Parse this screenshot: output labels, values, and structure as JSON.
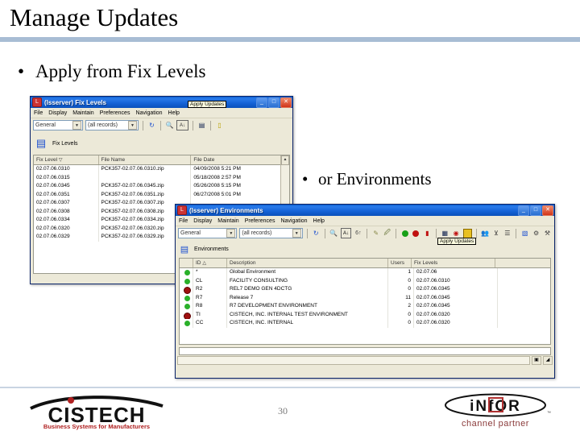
{
  "slide": {
    "title": "Manage Updates",
    "bullet1": "Apply from Fix Levels",
    "bullet2": "or Environments",
    "page_number": "30",
    "rule_color": "#a8bdd4"
  },
  "fixlevels_window": {
    "title": "(lsserver) Fix Levels",
    "icon": "app-icon",
    "min_label": "_",
    "max_label": "□",
    "close_label": "✕",
    "menus": [
      "File",
      "Display",
      "Maintain",
      "Preferences",
      "Navigation",
      "Help"
    ],
    "toolbar": {
      "view_combo": "General",
      "filter_combo": "(all records)",
      "refresh_icon": "refresh-icon",
      "find_icon": "binoculars-icon",
      "sort_icon": "sort-icon",
      "export_icon": "export-icon",
      "note_icon": "note-icon"
    },
    "panel_label": "Fix Levels",
    "tooltip": "Apply Updates",
    "columns": [
      "Fix Level",
      "File Name",
      "File Date"
    ],
    "rows": [
      {
        "level": "02.07.06.0310",
        "file": "PCK357-02.07.06.0310.zip",
        "date": "04/09/2008 5:21 PM"
      },
      {
        "level": "02.07.06.0315",
        "file": "",
        "date": "05/18/2008 2:57 PM"
      },
      {
        "level": "02.07.06.0345",
        "file": "PCK357-02.07.06.0345.zip",
        "date": "05/26/2008 5:15 PM"
      },
      {
        "level": "02.07.06.0351",
        "file": "PCK357-02.07.06.0351.zip",
        "date": "06/27/2008 5:01 PM"
      },
      {
        "level": "02.07.06.0307",
        "file": "PCK357-02.07.06.0307.zip",
        "date": ""
      },
      {
        "level": "02.07.06.0308",
        "file": "PCK357-02.07.06.0308.zip",
        "date": ""
      },
      {
        "level": "02.07.06.0334",
        "file": "PCK357-02.07.06.0334.zip",
        "date": ""
      },
      {
        "level": "02.07.06.0320",
        "file": "PCK357-02.07.06.0320.zip",
        "date": ""
      },
      {
        "level": "02.07.06.0329",
        "file": "PCK357-02.07.06.0329.zip",
        "date": ""
      }
    ]
  },
  "environments_window": {
    "title": "(lsserver) Environments",
    "icon": "app-icon",
    "min_label": "_",
    "max_label": "□",
    "close_label": "✕",
    "menus": [
      "File",
      "Display",
      "Maintain",
      "Preferences",
      "Navigation",
      "Help"
    ],
    "toolbar": {
      "view_combo": "General",
      "filter_combo": "(all records)",
      "refresh_icon": "refresh-icon",
      "find_icon": "binoculars-icon",
      "sort_icon": "sort-icon",
      "filter_icon": "filter-icon",
      "edit_icon": "pencil-icon",
      "new_icon": "new-doc-icon",
      "start_icon": "green-circle-icon",
      "stop_icon": "red-stop-icon",
      "restart_icon": "red-pin-icon",
      "users_icon": "users-icon",
      "globe_icon": "globe-icon",
      "apply_icon": "apply-updates-icon",
      "people_icon": "people-icon",
      "funnel_icon": "funnel-icon",
      "list_icon": "list-icon",
      "chart_icon": "chart-icon",
      "gear1_icon": "gear-icon",
      "gear2_icon": "settings-icon"
    },
    "panel_label": "Environments",
    "tooltip": "Apply Updates",
    "columns": [
      "ID",
      "Description",
      "Users",
      "Fix Levels"
    ],
    "rows": [
      {
        "status": "ok",
        "color": "#2ab02a",
        "id": "*",
        "description": "Global Environment",
        "users": "1",
        "fix": "02.07.06"
      },
      {
        "status": "ok",
        "color": "#2ab02a",
        "id": "CL",
        "description": "FACILITY CONSULTING",
        "users": "0",
        "fix": "02.07.06.0310"
      },
      {
        "status": "stop",
        "color": "#a01010",
        "id": "R2",
        "description": "REL7 DEMO GEN 4DCTG",
        "users": "0",
        "fix": "02.07.06.0345"
      },
      {
        "status": "ok",
        "color": "#2ab02a",
        "id": "R7",
        "description": "Release 7",
        "users": "11",
        "fix": "02.07.06.0345"
      },
      {
        "status": "ok",
        "color": "#2ab02a",
        "id": "R8",
        "description": "R7 DEVELOPMENT ENVIRONMENT",
        "users": "2",
        "fix": "02.07.06.0345"
      },
      {
        "status": "stop",
        "color": "#a01010",
        "id": "TI",
        "description": "CISTECH, INC. INTERNAL TEST ENVIRONMENT",
        "users": "0",
        "fix": "02.07.06.0320"
      },
      {
        "status": "ok",
        "color": "#2ab02a",
        "id": "CC",
        "description": "CISTECH, INC. INTERNAL",
        "users": "0",
        "fix": "02.07.06.0320"
      }
    ]
  },
  "footer": {
    "cistech_name": "CISTECH",
    "cistech_tagline": "Business Systems for Manufacturers",
    "infor_name": "iNfOR",
    "infor_sub": "channel partner",
    "infor_accent": "#b03030"
  }
}
